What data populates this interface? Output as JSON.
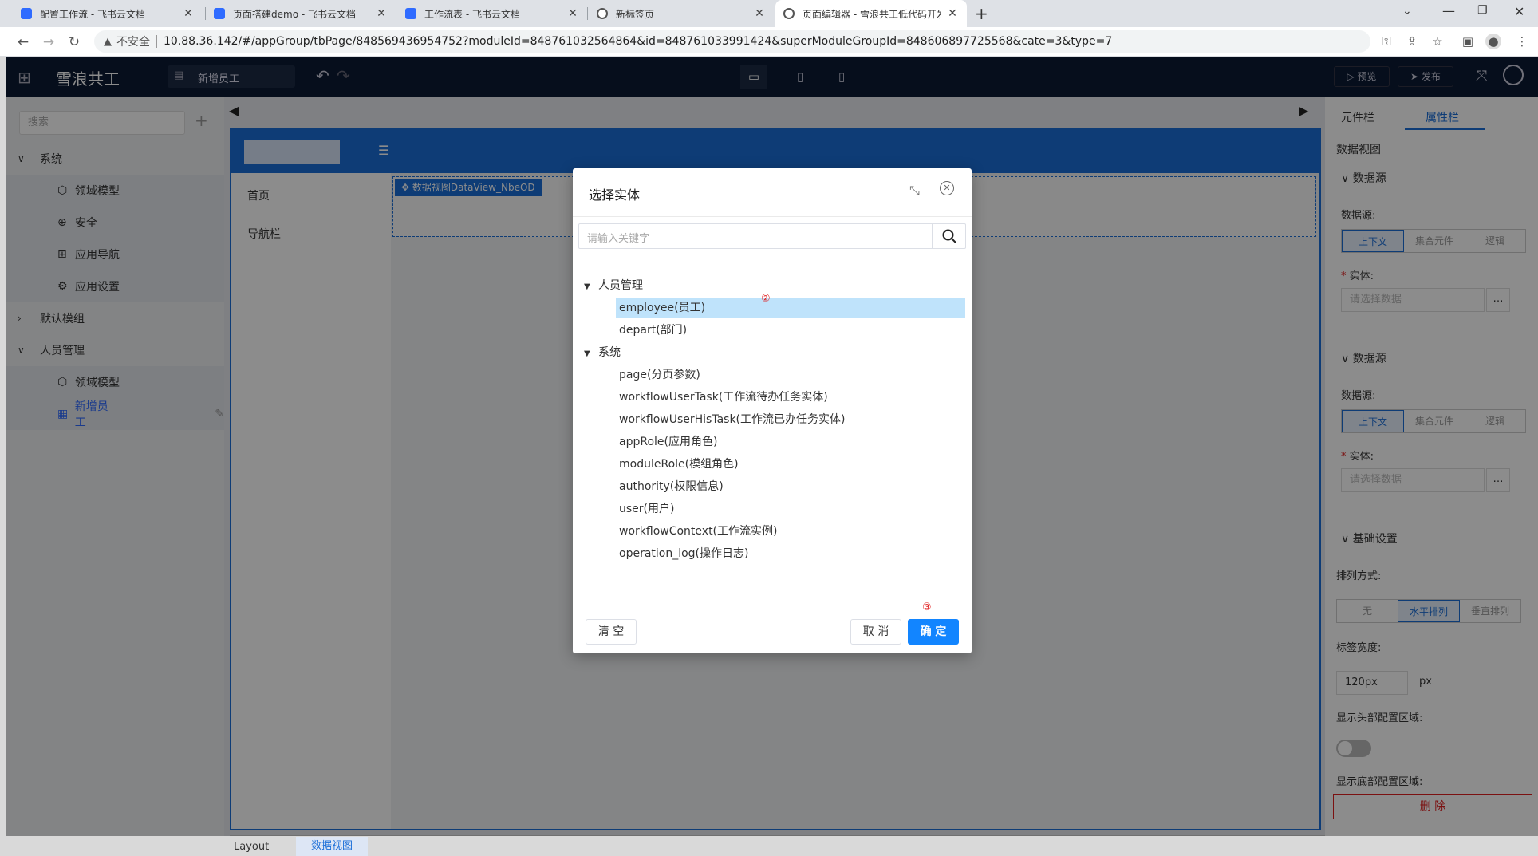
{
  "browser": {
    "tabs": [
      {
        "title": "配置工作流 - 飞书云文档",
        "fav_color": "#2f6bff"
      },
      {
        "title": "页面搭建demo - 飞书云文档",
        "fav_color": "#2f6bff"
      },
      {
        "title": "工作流表 - 飞书云文档",
        "fav_color": "#2f6bff"
      },
      {
        "title": "新标签页",
        "fav_color": "#555555"
      },
      {
        "title": "页面编辑器 - 雪浪共工低代码开发",
        "fav_color": "#555555"
      }
    ],
    "insecure_label": "不安全",
    "url": "10.88.36.142/#/appGroup/tbPage/848569436954752?moduleId=848761032564864&id=848761033991424&superModuleGroupId=848606897725568&cate=3&type=7"
  },
  "app": {
    "brand": "雪浪共工",
    "page_name": "新增员工",
    "preview_label": "预览",
    "publish_label": "发布",
    "left": {
      "search_placeholder": "搜索",
      "tree": [
        {
          "label": "系统",
          "level": 0,
          "expanded": true
        },
        {
          "label": "领域模型",
          "level": 1,
          "icon": "cube-icon"
        },
        {
          "label": "安全",
          "level": 1,
          "icon": "shield-icon"
        },
        {
          "label": "应用导航",
          "level": 1,
          "icon": "grid-icon"
        },
        {
          "label": "应用设置",
          "level": 1,
          "icon": "gear-icon"
        },
        {
          "label": "默认模组",
          "level": 0,
          "expanded": false
        },
        {
          "label": "人员管理",
          "level": 0,
          "expanded": true
        },
        {
          "label": "领域模型",
          "level": 1,
          "icon": "cube-icon"
        },
        {
          "label": "新增员工",
          "level": 1,
          "icon": "table-icon",
          "active": true
        }
      ]
    },
    "canvas": {
      "nav_items": [
        "首页",
        "导航栏"
      ],
      "component_label": "数据视图DataView_NbeOD",
      "breadcrumb": [
        "Layout",
        "数据视图"
      ]
    },
    "right": {
      "tabs": [
        "元件栏",
        "属性栏"
      ],
      "active_tab": "属性栏",
      "section_title": "数据视图",
      "groups": [
        {
          "title": "数据源",
          "ds_label": "数据源:",
          "options": [
            "上下文",
            "集合元件",
            "逻辑"
          ],
          "entity_label": "实体:",
          "entity_placeholder": "请选择数据"
        },
        {
          "title": "数据源",
          "ds_label": "数据源:",
          "options": [
            "上下文",
            "集合元件",
            "逻辑"
          ],
          "entity_label": "实体:",
          "entity_placeholder": "请选择数据"
        }
      ],
      "basic": {
        "title": "基础设置",
        "sort_label": "排列方式:",
        "sort_options": [
          "无",
          "水平排列",
          "垂直排列"
        ],
        "label_width_label": "标签宽度:",
        "label_width_value": "120px",
        "label_width_unit": "px",
        "show_header_label": "显示头部配置区域:",
        "show_footer_label": "显示底部配置区域:",
        "delete_label": "删 除"
      }
    }
  },
  "modal": {
    "title": "选择实体",
    "search_placeholder": "请输入关键字",
    "groups": [
      {
        "label": "人员管理",
        "items": [
          "employee(员工)",
          "depart(部门)"
        ]
      },
      {
        "label": "系统",
        "items": [
          "page(分页参数)",
          "workflowUserTask(工作流待办任务实体)",
          "workflowUserHisTask(工作流已办任务实体)",
          "appRole(应用角色)",
          "moduleRole(模组角色)",
          "authority(权限信息)",
          "user(用户)",
          "workflowContext(工作流实例)",
          "operation_log(操作日志)"
        ]
      }
    ],
    "selected": "employee(员工)",
    "clear_label": "清 空",
    "cancel_label": "取 消",
    "confirm_label": "确 定",
    "marker_2": "②",
    "marker_3": "③"
  }
}
